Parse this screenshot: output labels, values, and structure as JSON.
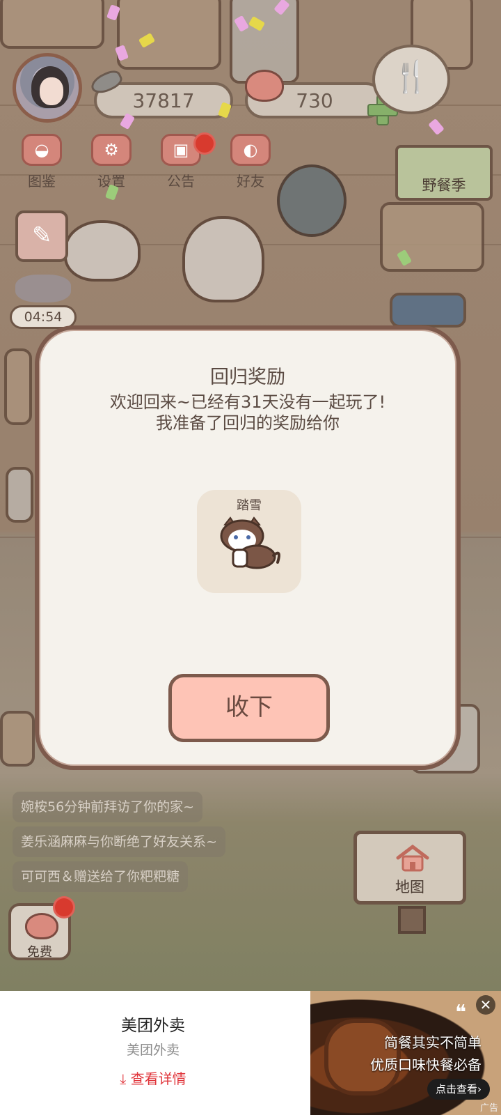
{
  "hud": {
    "coins": "37817",
    "hearts": "730",
    "timer": "04:54",
    "event_sign": "野餐季"
  },
  "menu": {
    "guide": "图鉴",
    "settings": "设置",
    "notice": "公告",
    "friends": "好友"
  },
  "feed": [
    "婉桉56分钟前拜访了你的家~",
    "姜乐涵麻麻与你断绝了好友关系~",
    "可可西＆赠送给了你粑粑糖"
  ],
  "map_label": "地图",
  "free_label": "免费",
  "modal": {
    "title": "回归奖励",
    "message_line1": "欢迎回来~已经有31天没有一起玩了!",
    "message_line2": "我准备了回归的奖励给你",
    "reward_name": "踏雪",
    "accept_label": "收下"
  },
  "ad": {
    "title": "美团外卖",
    "subtitle": "美团外卖",
    "details": "查看详情",
    "line1": "简餐其实不简单",
    "line2": "优质口味快餐必备",
    "cta": "点击查看›",
    "quote": "❝",
    "close": "✕",
    "label": "广告"
  },
  "colors": {
    "accent_button": "#fec4b6",
    "modal_border": "#7d5a4c",
    "ad_link": "#e0343a",
    "notification_dot": "#d83a2e"
  }
}
